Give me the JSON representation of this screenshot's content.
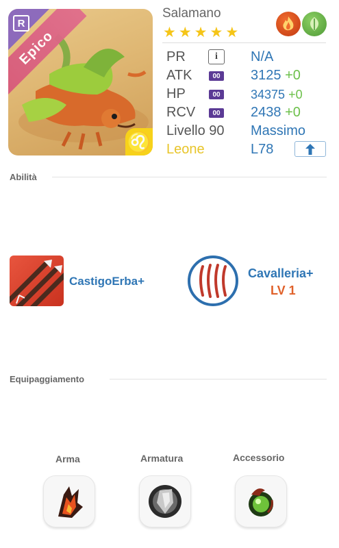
{
  "hero": {
    "name": "Salamano",
    "stars": 5,
    "rarity": "Epico",
    "rank_badge": "R",
    "zodiac_symbol": "♌",
    "elements": [
      "fire",
      "leaf"
    ]
  },
  "stats": {
    "pr": {
      "label": "PR",
      "value": "N/A"
    },
    "atk": {
      "label": "ATK",
      "tag": "00",
      "value": "3125",
      "bonus": "+0"
    },
    "hp": {
      "label": "HP",
      "tag": "00",
      "value": "34375",
      "bonus": "+0"
    },
    "rcv": {
      "label": "RCV",
      "tag": "00",
      "value": "2438",
      "bonus": "+0"
    },
    "level": {
      "label": "Livello 90",
      "value": "Massimo"
    },
    "sign": {
      "label": "Leone",
      "value": "L78"
    }
  },
  "abilities": {
    "title": "Abilità",
    "skill1": {
      "name": "CastigoErba+",
      "icon": "arrows-icon"
    },
    "skill2": {
      "name": "Cavalleria+",
      "level": "LV 1",
      "icon": "claw-scratch-icon"
    }
  },
  "equipment": {
    "title": "Equipaggiamento",
    "slots": [
      {
        "label": "Arma",
        "icon": "fire-weapon-icon"
      },
      {
        "label": "Armatura",
        "icon": "shield-armor-icon"
      },
      {
        "label": "Accessorio",
        "icon": "green-orb-accessory-icon"
      }
    ]
  },
  "colors": {
    "accent_blue": "#2f76b5",
    "bonus_green": "#6cc04a",
    "gold": "#e8c52a",
    "level_orange": "#e0612a"
  }
}
